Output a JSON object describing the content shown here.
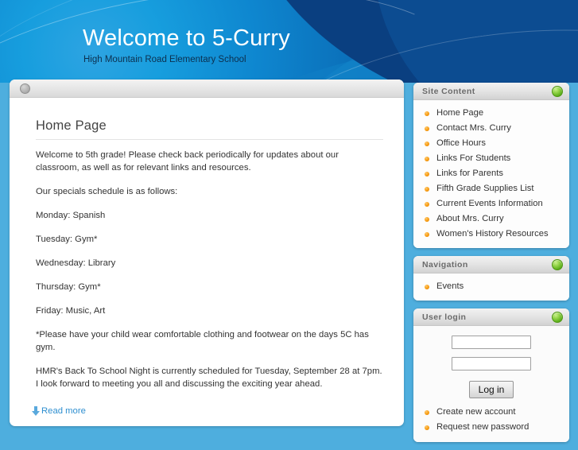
{
  "banner": {
    "title": "Welcome to 5-Curry",
    "slogan": "High Mountain Road Elementary School"
  },
  "content": {
    "page_title": "Home Page",
    "paragraphs": [
      "Welcome to 5th grade!  Please check back periodically for updates about our classroom, as well as for relevant links and resources.",
      "Our specials schedule is as follows:",
      "Monday: Spanish",
      "Tuesday: Gym*",
      "Wednesday: Library",
      "Thursday: Gym*",
      "Friday: Music, Art",
      "*Please have your child wear comfortable clothing and footwear on the days 5C has gym.",
      "HMR's Back To School Night is currently scheduled for Tuesday, September 28 at 7pm.  I look forward to meeting you all and discussing the exciting year ahead."
    ],
    "read_more_label": "Read more"
  },
  "sidebar": {
    "site_content": {
      "title": "Site Content",
      "items": [
        "Home Page",
        "Contact Mrs. Curry",
        "Office Hours",
        "Links For Students",
        "Links for Parents",
        "Fifth Grade Supplies List",
        "Current Events Information",
        "About Mrs. Curry",
        "Women's History Resources"
      ]
    },
    "navigation": {
      "title": "Navigation",
      "items": [
        "Events"
      ]
    },
    "user_login": {
      "title": "User login",
      "username_value": "",
      "password_value": "",
      "login_button_label": "Log in",
      "links": [
        "Create new account",
        "Request new password"
      ]
    }
  },
  "colors": {
    "banner_blue": "#0b74c0",
    "page_background": "#4eaede",
    "bullet_orange": "#f79c12",
    "collapse_green": "#59ad18",
    "link_blue": "#2f8fd0"
  }
}
